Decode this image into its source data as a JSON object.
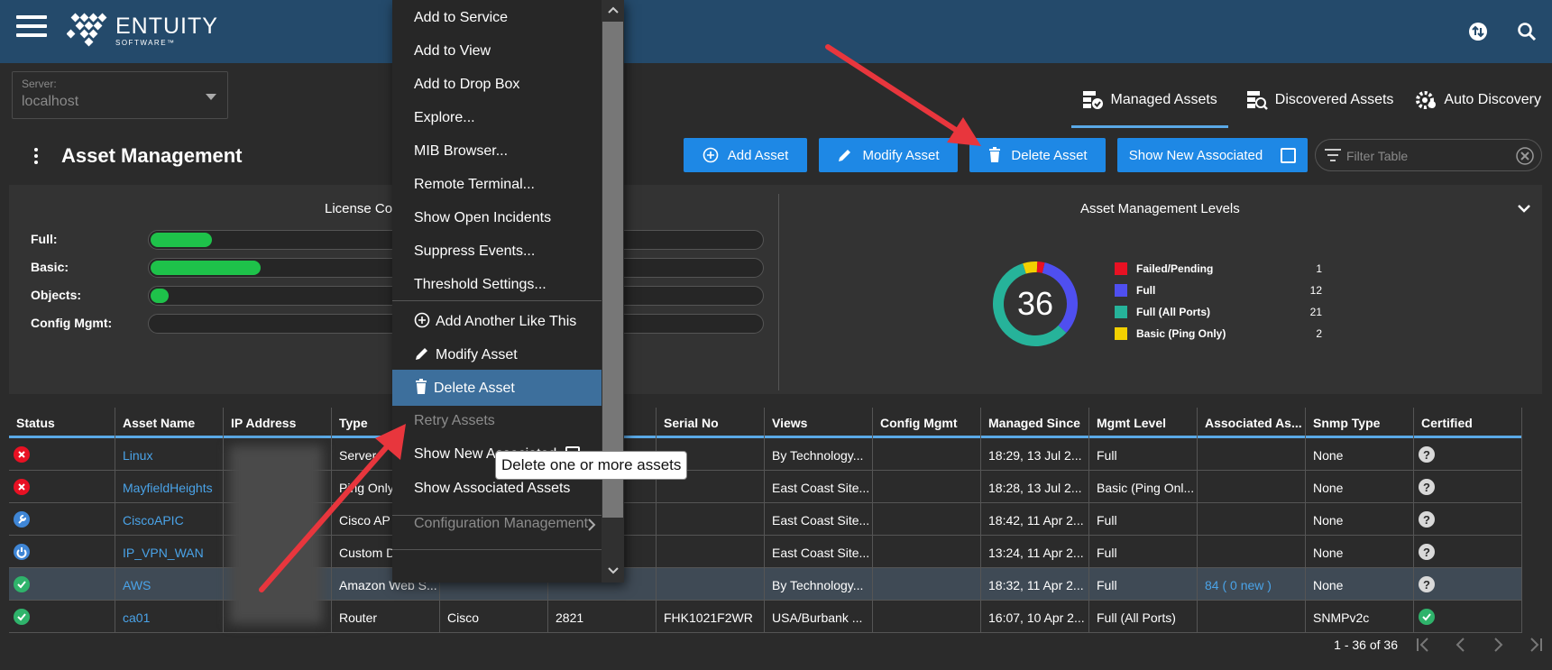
{
  "header": {
    "logo_name": "ENTUITY",
    "logo_sub": "SOFTWARE™",
    "icons": [
      "hamburger-menu-icon",
      "sync-icon",
      "search-icon"
    ]
  },
  "server": {
    "label": "Server:",
    "value": "localhost"
  },
  "tabs": [
    {
      "label": "Managed Assets",
      "icon": "managed-assets-icon",
      "active": true
    },
    {
      "label": "Discovered Assets",
      "icon": "discovered-assets-icon",
      "active": false
    },
    {
      "label": "Auto Discovery",
      "icon": "auto-discovery-icon",
      "active": false
    }
  ],
  "page": {
    "title": "Asset Management"
  },
  "toolbar": {
    "add_label": "Add Asset",
    "modify_label": "Modify Asset",
    "delete_label": "Delete Asset",
    "show_new_label": "Show New Associated",
    "filter_placeholder": "Filter Table"
  },
  "license": {
    "title": "License Co",
    "rows": [
      {
        "label": "Full:",
        "fill": 0.1
      },
      {
        "label": "Basic:",
        "fill": 0.18
      },
      {
        "label": "Objects:",
        "fill": 0.03
      },
      {
        "label": "Config Mgmt:",
        "fill": 0
      }
    ],
    "fill_color": "#1ec24a"
  },
  "levels": {
    "title": "Asset Management Levels",
    "total": "36",
    "items": [
      {
        "name": "Failed/Pending",
        "value": 1,
        "color": "#e81123"
      },
      {
        "name": "Full",
        "value": 12,
        "color": "#4f4ff0"
      },
      {
        "name": "Full (All Ports)",
        "value": 21,
        "color": "#26b39a"
      },
      {
        "name": "Basic (Ping Only)",
        "value": 2,
        "color": "#f2d000"
      }
    ]
  },
  "table": {
    "columns": [
      "Status",
      "Asset Name",
      "IP Address",
      "Type",
      "",
      "",
      "Serial No",
      "Views",
      "Config Mgmt",
      "Managed Since",
      "Mgmt Level",
      "Associated As...",
      "Snmp Type",
      "Certified"
    ],
    "rows": [
      {
        "status": "failed",
        "name": "Linux",
        "type": "Server",
        "vendor": "",
        "model": "",
        "serial": "",
        "views": "By Technology...",
        "config": "",
        "since": "18:29, 13 Jul 2...",
        "level": "Full",
        "assoc": "",
        "snmp": "None",
        "cert": "unknown"
      },
      {
        "status": "failed",
        "name": "MayfieldHeights",
        "type": "Ping Only",
        "vendor": "",
        "model": "",
        "serial": "",
        "views": "East Coast Site...",
        "config": "",
        "since": "18:28, 13 Jul 2...",
        "level": "Basic (Ping Onl...",
        "assoc": "",
        "snmp": "None",
        "cert": "unknown"
      },
      {
        "status": "wrench",
        "name": "CiscoAPIC",
        "type": "Cisco AP",
        "vendor": "",
        "model": "",
        "serial": "",
        "views": "East Coast Site...",
        "config": "",
        "since": "18:42, 11 Apr 2...",
        "level": "Full",
        "assoc": "",
        "snmp": "None",
        "cert": "unknown"
      },
      {
        "status": "power",
        "name": "IP_VPN_WAN",
        "type": "Custom D",
        "vendor": "",
        "model": "",
        "serial": "",
        "views": "East Coast Site...",
        "config": "",
        "since": "13:24, 11 Apr 2...",
        "level": "Full",
        "assoc": "",
        "snmp": "None",
        "cert": "unknown"
      },
      {
        "status": "ok",
        "name": "AWS",
        "type": "Amazon Web S...",
        "vendor": "",
        "model": "",
        "serial": "",
        "views": "By Technology...",
        "config": "",
        "since": "18:32, 11 Apr 2...",
        "level": "Full",
        "assoc": "84 ( 0 new )",
        "snmp": "None",
        "cert": "unknown"
      },
      {
        "status": "ok",
        "name": "ca01",
        "type": "Router",
        "vendor": "Cisco",
        "model": "2821",
        "serial": "FHK1021F2WR",
        "views": "USA/Burbank ...",
        "config": "",
        "since": "16:07, 10 Apr 2...",
        "level": "Full (All Ports)",
        "assoc": "",
        "snmp": "SNMPv2c",
        "cert": "ok"
      }
    ],
    "pagination": "1 - 36 of 36"
  },
  "context_menu": {
    "items": [
      {
        "label": "Add to Service"
      },
      {
        "label": "Add to View"
      },
      {
        "label": "Add to Drop Box"
      },
      {
        "label": "Explore..."
      },
      {
        "label": "MIB Browser..."
      },
      {
        "label": "Remote Terminal..."
      },
      {
        "label": "Show Open Incidents"
      },
      {
        "label": "Suppress Events..."
      },
      {
        "label": "Threshold Settings..."
      },
      {
        "label": "Add Another Like This",
        "icon": "add-circle-icon"
      },
      {
        "label": "Modify Asset",
        "icon": "pencil-icon"
      },
      {
        "label": "Delete Asset",
        "icon": "trash-icon"
      },
      {
        "label": "Retry Assets"
      },
      {
        "label": "Show New Associated"
      },
      {
        "label": "Show Associated Assets"
      },
      {
        "label": "Configuration Management"
      }
    ],
    "tooltip": "Delete one or more assets"
  }
}
